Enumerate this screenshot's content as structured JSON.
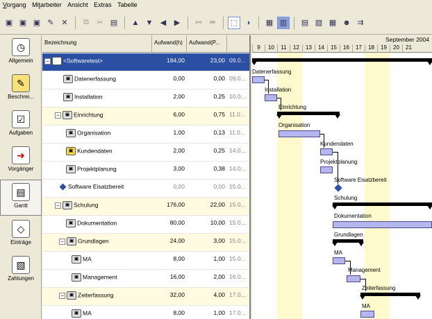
{
  "menu": [
    {
      "label": "Vorgang",
      "underline": "V",
      "rest": "organg"
    },
    {
      "label": "Mitarbeiter",
      "pre": "Mi",
      "underline": "t",
      "rest": "arbeiter"
    },
    {
      "label": "Ansicht"
    },
    {
      "label": "Extras"
    },
    {
      "label": "Tabelle"
    }
  ],
  "nav": [
    {
      "label": "Allgemein",
      "icon": "clock-icon"
    },
    {
      "label": "Beschrei...",
      "icon": "notepad-icon"
    },
    {
      "label": "Aufgaben",
      "icon": "checklist-icon"
    },
    {
      "label": "Vorgänger",
      "icon": "arrow-doc-icon"
    },
    {
      "label": "Gantt",
      "icon": "gantt-icon"
    },
    {
      "label": "Einträge",
      "icon": "stack-icon"
    },
    {
      "label": "Zahlungen",
      "icon": "payment-icon"
    }
  ],
  "grid": {
    "headers": {
      "name": "Bezeichnung",
      "effort": "Aufwand(h)",
      "effort_p": "Aufwand(P..."
    },
    "rows": [
      {
        "name": "<Softwaretest>",
        "effort": "184,00",
        "effort_p": "23,00",
        "date": "09.0..."
      },
      {
        "name": "Datenerfassung",
        "effort": "0,00",
        "effort_p": "0,00",
        "date": "09.0..."
      },
      {
        "name": "Installation",
        "effort": "2,00",
        "effort_p": "0,25",
        "date": "10.0..."
      },
      {
        "name": "Einrichtung",
        "effort": "6,00",
        "effort_p": "0,75",
        "date": "11.0..."
      },
      {
        "name": "Organisation",
        "effort": "1,00",
        "effort_p": "0,13",
        "date": "11.0..."
      },
      {
        "name": "Kundendaten",
        "effort": "2,00",
        "effort_p": "0,25",
        "date": "14.0..."
      },
      {
        "name": "Projektplanung",
        "effort": "3,00",
        "effort_p": "0,38",
        "date": "14.0..."
      },
      {
        "name": "Software Eisatzbereit",
        "effort": "0,00",
        "effort_p": "0,00",
        "date": "15.0..."
      },
      {
        "name": "Schulung",
        "effort": "176,00",
        "effort_p": "22,00",
        "date": "15.0..."
      },
      {
        "name": "Dokumentation",
        "effort": "80,00",
        "effort_p": "10,00",
        "date": "15.0..."
      },
      {
        "name": "Grundlagen",
        "effort": "24,00",
        "effort_p": "3,00",
        "date": "15.0..."
      },
      {
        "name": "MA",
        "effort": "8,00",
        "effort_p": "1,00",
        "date": "15.0..."
      },
      {
        "name": "Management",
        "effort": "16,00",
        "effort_p": "2,00",
        "date": "16.0..."
      },
      {
        "name": "Zeiterfassung",
        "effort": "32,00",
        "effort_p": "4,00",
        "date": "17.0..."
      },
      {
        "name": "MA",
        "effort": "8,00",
        "effort_p": "1,00",
        "date": "17.0..."
      }
    ]
  },
  "gantt": {
    "month": "September 2004",
    "days": [
      "9",
      "10",
      "11",
      "12",
      "13",
      "14",
      "15",
      "16",
      "17",
      "18",
      "19",
      "20",
      "21"
    ],
    "labels": {
      "datenerfassung": "Datenerfassung",
      "installation": "Installation",
      "einrichtung": "Einrichtung",
      "organisation": "Organisation",
      "kundendaten": "Kundendaten",
      "projektplanung": "Projektplanung",
      "software": "Software Eisatzbereit",
      "schulung": "Schulung",
      "dokumentation": "Dokumentation",
      "grundlagen": "Grundlagen",
      "ma": "MA",
      "management": "Management",
      "zeiterfassung": "Zeiterfassung",
      "ma2": "MA"
    }
  }
}
